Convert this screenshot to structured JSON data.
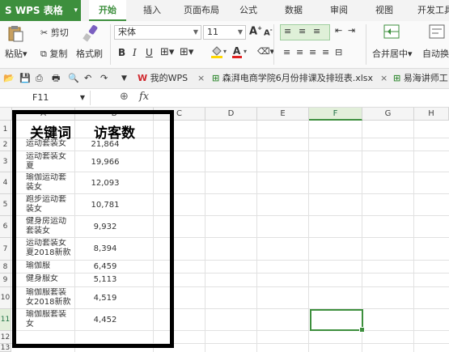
{
  "app": {
    "name": "WPS 表格"
  },
  "menu": {
    "tabs": [
      "开始",
      "插入",
      "页面布局",
      "公式",
      "数据",
      "审阅",
      "视图",
      "开发工具"
    ],
    "active": "开始"
  },
  "ribbon": {
    "cut": "剪切",
    "paste": "粘贴",
    "copy": "复制",
    "format_painter": "格式刷",
    "font_name": "宋体",
    "font_size": "11",
    "bold": "B",
    "italic": "I",
    "underline": "U",
    "font_grow": "A",
    "font_shrink": "A",
    "merge_center": "合并居中",
    "auto_wrap": "自动换"
  },
  "quick_access": {
    "my_wps": "我的WPS",
    "doc_tab_1": "森湃电商学院6月份排课及排班表.xlsx",
    "doc_tab_2": "易海讲师工"
  },
  "formula_bar": {
    "cell_ref": "F11",
    "fx": "fx",
    "content": ""
  },
  "grid": {
    "columns": [
      "A",
      "B",
      "C",
      "D",
      "E",
      "F",
      "G",
      "H"
    ],
    "selected_column": "F",
    "rows": [
      "1",
      "2",
      "3",
      "4",
      "5",
      "6",
      "7",
      "8",
      "9",
      "10",
      "11",
      "12",
      "13"
    ],
    "selected_row": "11",
    "header": {
      "a": "关键词",
      "b": "访客数"
    },
    "data": [
      {
        "keyword": "运动套装女",
        "visitors": "21,864"
      },
      {
        "keyword": "运动套装女夏",
        "visitors": "19,966"
      },
      {
        "keyword": "瑜伽运动套装女",
        "visitors": "12,093"
      },
      {
        "keyword": "跑步运动套装女",
        "visitors": "10,781"
      },
      {
        "keyword": "健身房运动套装女",
        "visitors": "9,932"
      },
      {
        "keyword": "运动套装女夏2018新款",
        "visitors": "8,394"
      },
      {
        "keyword": "瑜伽服",
        "visitors": "6,459"
      },
      {
        "keyword": "健身服女",
        "visitors": "5,113"
      },
      {
        "keyword": "瑜伽服套装女2018新款",
        "visitors": "4,519"
      },
      {
        "keyword": "瑜伽服套装女",
        "visitors": "4,452"
      }
    ]
  },
  "colors": {
    "accent": "#3d8f3d",
    "frame": "#000000"
  }
}
